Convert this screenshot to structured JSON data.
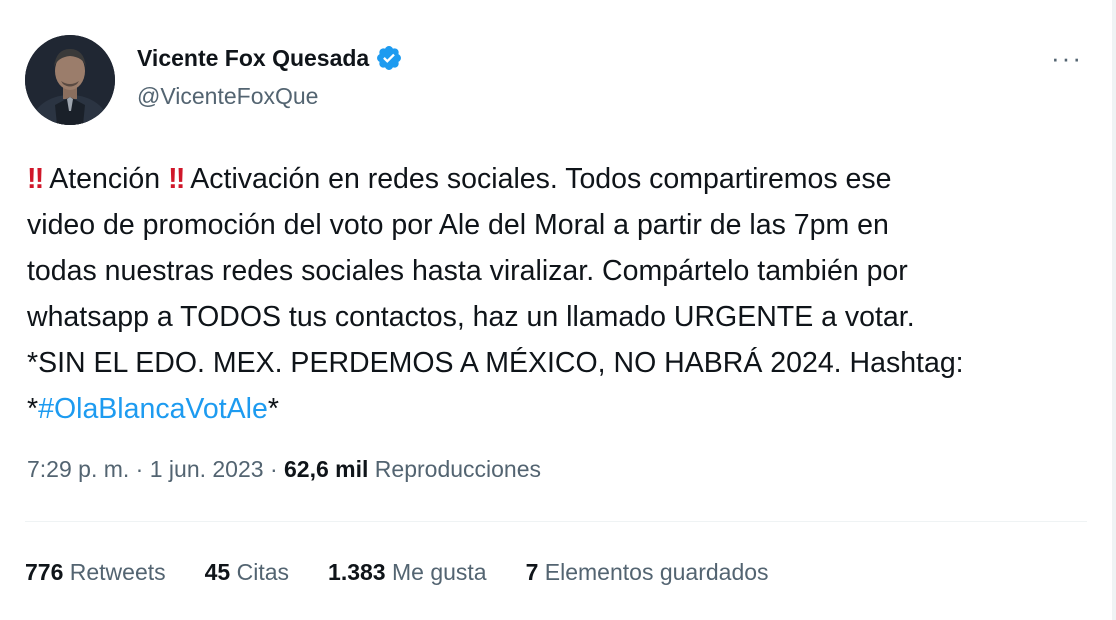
{
  "author": {
    "name": "Vicente Fox Quesada",
    "handle": "@VicenteFoxQue",
    "avatar_icon": "profile-photo",
    "verified_icon": "verified-badge-icon",
    "verified_color": "#1d9bf0"
  },
  "more_label": "···",
  "tweet": {
    "line1_bang1": "‼",
    "line1_word": "Atención",
    "line1_bang2": "‼",
    "line1_rest": "Activación en redes sociales. Todos compartiremos ese",
    "line2": "video de promoción del voto por Ale del Moral a partir de las 7pm en",
    "line3": "todas nuestras redes sociales hasta viralizar. Compártelo también por",
    "line4": "whatsapp a TODOS tus contactos, haz un llamado URGENTE a votar.",
    "line5": "*SIN EL EDO. MEX. PERDEMOS A MÉXICO, NO HABRÁ 2024. Hashtag:",
    "line6_prefix": "*",
    "hashtag": "#OlaBlancaVotAle",
    "line6_suffix": "*"
  },
  "meta": {
    "time": "7:29 p. m.",
    "sep1": " · ",
    "date": "1 jun. 2023",
    "sep2": " · ",
    "views_count": "62,6 mil",
    "views_label": " Reproducciones"
  },
  "stats": [
    {
      "count": "776",
      "label": "Retweets"
    },
    {
      "count": "45",
      "label": "Citas"
    },
    {
      "count": "1.383",
      "label": "Me gusta"
    },
    {
      "count": "7",
      "label": "Elementos guardados"
    }
  ],
  "colors": {
    "accent": "#1d9bf0",
    "alert": "#d0172a",
    "text": "#0f1419",
    "secondary": "#536471"
  }
}
